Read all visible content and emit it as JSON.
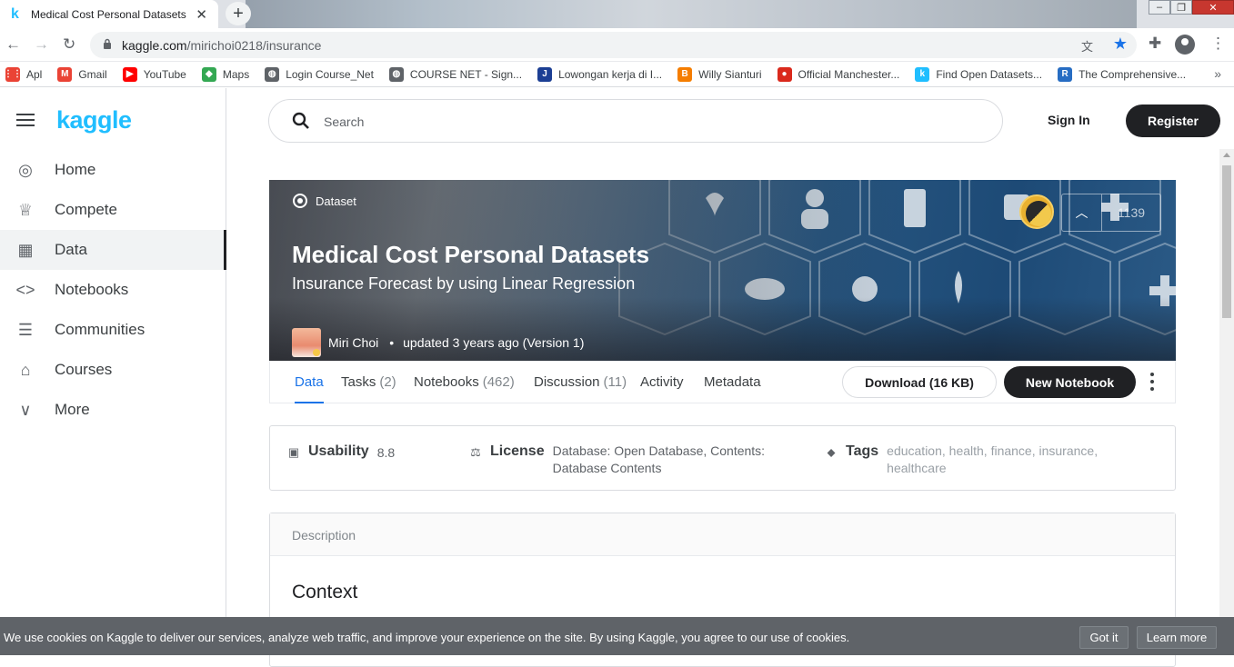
{
  "browser": {
    "tab_title": "Medical Cost Personal Datasets |",
    "url_host": "kaggle.com",
    "url_path": "/mirichoi0218/insurance",
    "bookmarks": [
      {
        "label": "Apl",
        "icon": "apps-grid-icon",
        "color": "#ea4335"
      },
      {
        "label": "Gmail",
        "icon": "gmail-icon",
        "color": "#ea4335"
      },
      {
        "label": "YouTube",
        "icon": "youtube-icon",
        "color": "#ff0000"
      },
      {
        "label": "Maps",
        "icon": "maps-icon",
        "color": "#34a853"
      },
      {
        "label": "Login Course_Net",
        "icon": "globe-icon",
        "color": "#5f6368"
      },
      {
        "label": "COURSE NET - Sign...",
        "icon": "globe-icon",
        "color": "#5f6368"
      },
      {
        "label": "Lowongan kerja di I...",
        "icon": "jobstreet-icon",
        "color": "#1c3f94"
      },
      {
        "label": "Willy Sianturi",
        "icon": "blogger-icon",
        "color": "#f57d00"
      },
      {
        "label": "Official Manchester...",
        "icon": "manutd-icon",
        "color": "#da291c"
      },
      {
        "label": "Find Open Datasets...",
        "icon": "kaggle-icon",
        "color": "#20beff"
      },
      {
        "label": "The Comprehensive...",
        "icon": "r-icon",
        "color": "#276dc3"
      }
    ]
  },
  "kaggle": {
    "logo": "kaggle",
    "nav": [
      {
        "label": "Home",
        "icon": "compass-icon"
      },
      {
        "label": "Compete",
        "icon": "trophy-icon"
      },
      {
        "label": "Data",
        "icon": "table-icon"
      },
      {
        "label": "Notebooks",
        "icon": "code-icon"
      },
      {
        "label": "Communities",
        "icon": "comment-icon"
      },
      {
        "label": "Courses",
        "icon": "school-icon"
      },
      {
        "label": "More",
        "icon": "chevron-down-icon"
      }
    ],
    "active_nav": "Data",
    "search_placeholder": "Search",
    "sign_in": "Sign In",
    "register": "Register"
  },
  "dataset": {
    "type_label": "Dataset",
    "title": "Medical Cost Personal Datasets",
    "subtitle": "Insurance Forecast by using Linear Regression",
    "author": "Miri Choi",
    "updated": "updated 3 years ago (Version 1)",
    "votes": "1139",
    "tabs": [
      {
        "label": "Data",
        "count": ""
      },
      {
        "label": "Tasks",
        "count": "(2)"
      },
      {
        "label": "Notebooks",
        "count": "(462)"
      },
      {
        "label": "Discussion",
        "count": "(11)"
      },
      {
        "label": "Activity",
        "count": ""
      },
      {
        "label": "Metadata",
        "count": ""
      }
    ],
    "download_label": "Download (16 KB)",
    "new_notebook_label": "New Notebook",
    "usability_label": "Usability",
    "usability_value": "8.8",
    "license_label": "License",
    "license_value_line1": "Database: Open Database, Contents:",
    "license_value_line2": "Database Contents",
    "tags_label": "Tags",
    "tags_line1": "education, health, finance, insurance,",
    "tags_line2": "healthcare",
    "description_header": "Description",
    "context_heading": "Context"
  },
  "cookie": {
    "message": "We use cookies on Kaggle to deliver our services, analyze web traffic, and improve your experience on the site. By using Kaggle, you agree to our use of cookies.",
    "got_it": "Got it",
    "learn_more": "Learn more"
  }
}
